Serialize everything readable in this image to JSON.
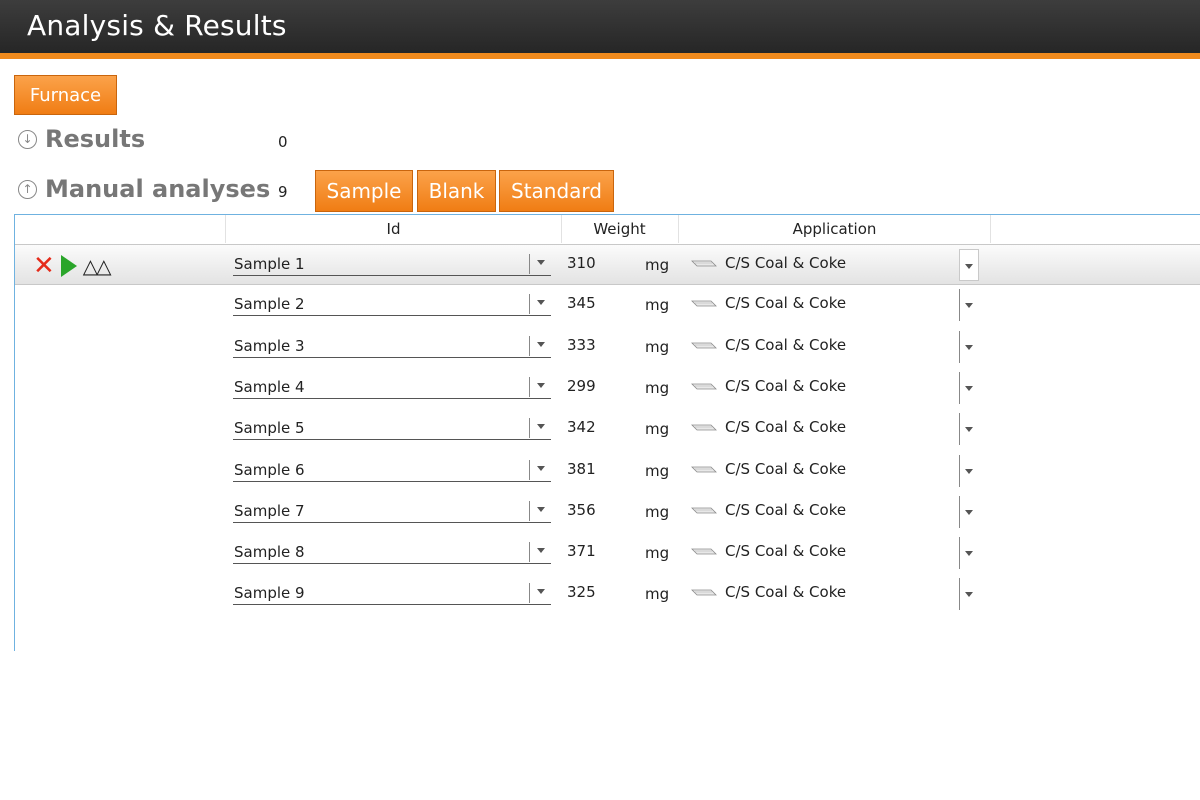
{
  "window": {
    "title": "Analysis & Results"
  },
  "toolbar": {
    "furnace_label": "Furnace"
  },
  "sections": {
    "results": {
      "label": "Results",
      "count": "0",
      "icon": "chevron-down-circle-icon"
    },
    "manual": {
      "label": "Manual analyses",
      "count": "9",
      "icon": "chevron-up-circle-icon"
    }
  },
  "add_buttons": {
    "sample": "Sample",
    "blank": "Blank",
    "standard": "Standard"
  },
  "table": {
    "columns": {
      "id": "Id",
      "weight": "Weight",
      "application": "Application"
    },
    "rows": [
      {
        "id": "Sample 1",
        "weight": "310",
        "unit": "mg",
        "application": "C/S Coal & Coke",
        "selected": true
      },
      {
        "id": "Sample 2",
        "weight": "345",
        "unit": "mg",
        "application": "C/S Coal & Coke"
      },
      {
        "id": "Sample 3",
        "weight": "333",
        "unit": "mg",
        "application": "C/S Coal & Coke"
      },
      {
        "id": "Sample 4",
        "weight": "299",
        "unit": "mg",
        "application": "C/S Coal & Coke"
      },
      {
        "id": "Sample 5",
        "weight": "342",
        "unit": "mg",
        "application": "C/S Coal & Coke"
      },
      {
        "id": "Sample 6",
        "weight": "381",
        "unit": "mg",
        "application": "C/S Coal & Coke"
      },
      {
        "id": "Sample 7",
        "weight": "356",
        "unit": "mg",
        "application": "C/S Coal & Coke"
      },
      {
        "id": "Sample 8",
        "weight": "371",
        "unit": "mg",
        "application": "C/S Coal & Coke"
      },
      {
        "id": "Sample 9",
        "weight": "325",
        "unit": "mg",
        "application": "C/S Coal & Coke"
      }
    ]
  },
  "row_actions": {
    "delete_icon": "close-icon",
    "run_icon": "play-icon",
    "weigh_icon": "balance-scale-icon"
  },
  "colors": {
    "accent": "#f08a1c",
    "titlebar": "#2e2e2e",
    "delete": "#e52b1a",
    "run": "#2aa52a",
    "grid_border": "#6fb2e0"
  }
}
